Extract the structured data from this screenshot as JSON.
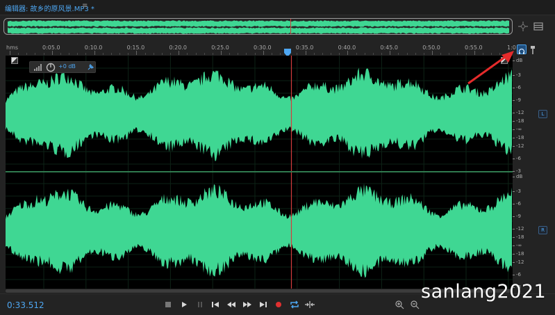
{
  "window": {
    "title": "编辑器: 故乡的原风景.MP3 *",
    "menu_glyph": "≡"
  },
  "overview": {
    "zoom_icon": "zoom-fit-icon",
    "panel_icon": "panel-toggle-icon"
  },
  "ruler": {
    "unit_label": "hms",
    "labels": [
      "0:05.0",
      "0:10.0",
      "0:15.0",
      "0:20.0",
      "0:25.0",
      "0:30.0",
      "0:35.0",
      "0:40.0",
      "0:45.0",
      "0:50.0",
      "0:55.0",
      "1:0"
    ],
    "playhead_fraction": 0.5637
  },
  "hud": {
    "level_label": "+0 dB",
    "icons": [
      "volume-bars-icon",
      "volume-knob-icon",
      "pin-icon"
    ]
  },
  "level_scale": {
    "unit": "dB",
    "top_labels": [
      "-3",
      "-6",
      "-9",
      "-12",
      "-18",
      "-∞",
      "-18",
      "-12",
      "-6",
      "-3"
    ],
    "bottom_labels": [
      "-3",
      "-6",
      "-9",
      "-12",
      "-18",
      "-∞",
      "-18",
      "-12",
      "-6",
      "-3"
    ]
  },
  "channels": {
    "left": "L",
    "right": "R"
  },
  "colors": {
    "waveform": "#3fd793",
    "playhead": "#d43c3c",
    "accent": "#4ea7f2",
    "annotation_arrow": "#e52b2b"
  },
  "transport": {
    "current_time": "0:33.512",
    "buttons": [
      "stop-icon",
      "play-icon",
      "pause-icon",
      "to-start-icon",
      "rewind-icon",
      "fast-forward-icon",
      "to-end-icon",
      "record-icon",
      "loop-icon",
      "skip-selection-icon"
    ],
    "zoom_buttons": [
      "zoom-in-amplitude-icon",
      "zoom-out-amplitude-icon",
      "zoom-in-time-icon",
      "zoom-out-time-icon",
      "zoom-full-icon",
      "zoom-selection-icon",
      "zoom-in-right-icon"
    ]
  },
  "watermark": "sanlang2021"
}
